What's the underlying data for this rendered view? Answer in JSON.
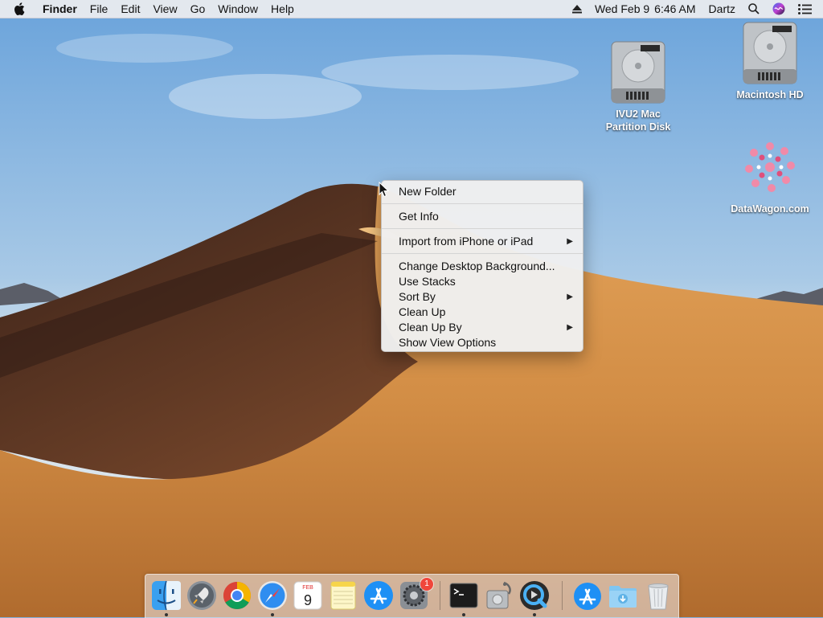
{
  "menubar": {
    "app_name": "Finder",
    "items": [
      "File",
      "Edit",
      "View",
      "Go",
      "Window",
      "Help"
    ],
    "clock": {
      "day": "Wed Feb 9",
      "time": "6:46 AM"
    },
    "user": "Dartz"
  },
  "desktop_icons": [
    {
      "label": "IVU2 Mac Partition Disk",
      "icon": "hard-disk-icon"
    },
    {
      "label": "Macintosh HD",
      "icon": "hard-disk-icon"
    },
    {
      "label": "DataWagon.com",
      "icon": "datawagon-logo-icon"
    }
  ],
  "context_menu": {
    "items": [
      {
        "label": "New Folder"
      },
      {
        "label": "Get Info"
      },
      {
        "label": "Import from iPhone or iPad",
        "submenu": true
      },
      {
        "label": "Change Desktop Background..."
      },
      {
        "label": "Use Stacks"
      },
      {
        "label": "Sort By",
        "submenu": true
      },
      {
        "label": "Clean Up"
      },
      {
        "label": "Clean Up By",
        "submenu": true
      },
      {
        "label": "Show View Options"
      }
    ]
  },
  "dock": {
    "apps": [
      {
        "name": "Finder",
        "icon": "finder-icon",
        "running": true
      },
      {
        "name": "Launchpad",
        "icon": "launchpad-icon",
        "running": false
      },
      {
        "name": "Google Chrome",
        "icon": "chrome-icon",
        "running": false
      },
      {
        "name": "Safari",
        "icon": "safari-icon",
        "running": true
      },
      {
        "name": "Calendar",
        "icon": "calendar-icon",
        "running": false,
        "month": "FEB",
        "day": "9"
      },
      {
        "name": "Notes",
        "icon": "notes-icon",
        "running": false
      },
      {
        "name": "App Store",
        "icon": "app-store-icon",
        "running": false
      },
      {
        "name": "System Preferences",
        "icon": "system-preferences-icon",
        "running": false,
        "badge": "1"
      },
      {
        "name": "Terminal",
        "icon": "terminal-icon",
        "running": true
      },
      {
        "name": "Disk Utility",
        "icon": "disk-utility-icon",
        "running": false
      },
      {
        "name": "QuickTime Player",
        "icon": "quicktime-icon",
        "running": true
      },
      {
        "name": "Applications",
        "icon": "applications-folder-icon",
        "running": false
      },
      {
        "name": "Downloads",
        "icon": "downloads-folder-icon",
        "running": false
      },
      {
        "name": "Trash",
        "icon": "trash-icon",
        "running": false
      }
    ]
  },
  "colors": {
    "sky": "#7fb1e0",
    "dune_light": "#d9964d",
    "dune_shadow": "#4a2d20",
    "badge": "#f0463b"
  }
}
